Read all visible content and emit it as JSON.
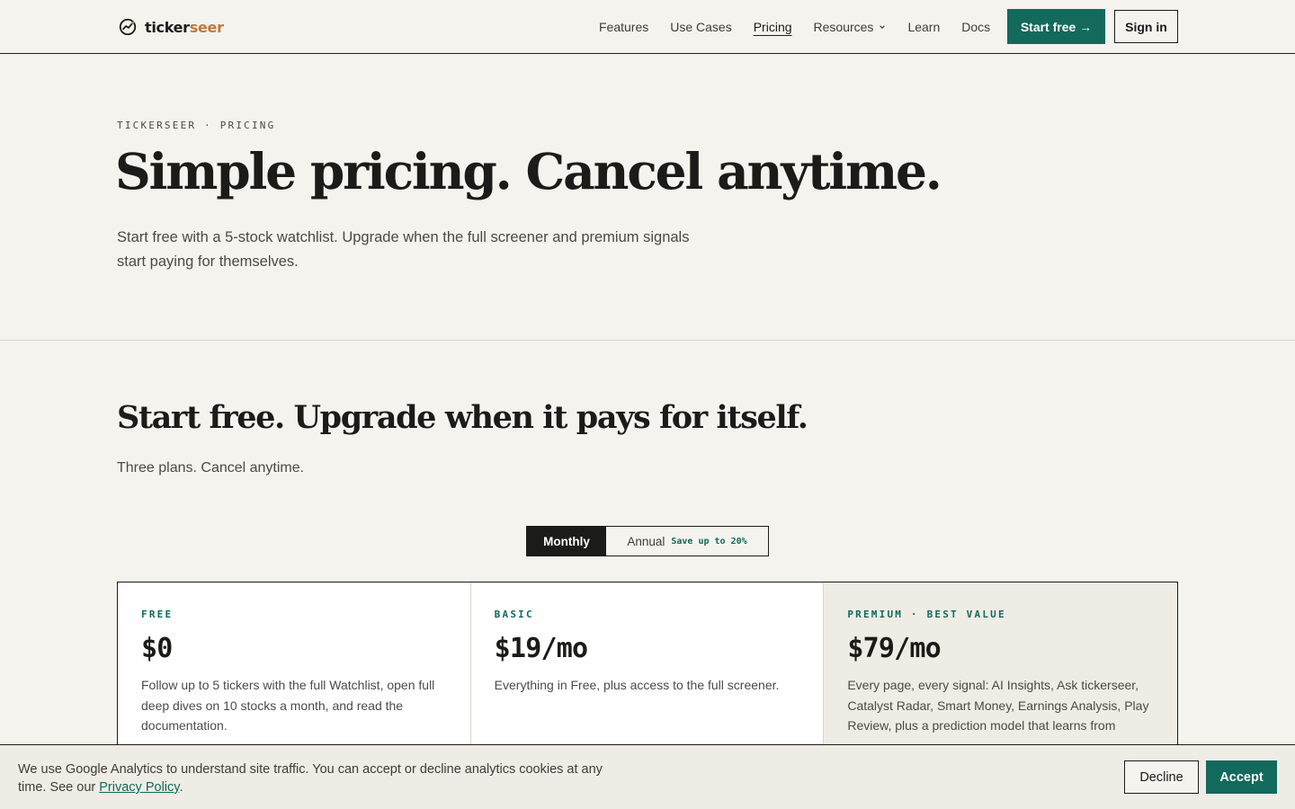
{
  "colors": {
    "accent": "#12695c",
    "brand_accent": "#c0783a",
    "ink": "#1b1b19",
    "background": "#f5f3ee",
    "premium_card_bg": "#efece5"
  },
  "nav": {
    "logo_icon": "trend-gauge-icon",
    "logo_primary": "ticker",
    "logo_accent": "seer",
    "links": [
      {
        "label": "Features"
      },
      {
        "label": "Use Cases"
      },
      {
        "label": "Pricing",
        "active": true
      },
      {
        "label": "Resources",
        "has_dropdown": true
      },
      {
        "label": "Learn"
      },
      {
        "label": "Docs"
      }
    ],
    "start_free": "Start free →",
    "sign_in": "Sign in"
  },
  "hero": {
    "eyebrow": "TICKERSEER · PRICING",
    "title": "Simple pricing. Cancel anytime.",
    "subtitle": "Start free with a 5-stock watchlist. Upgrade when the full screener and premium signals start paying for themselves."
  },
  "pricing": {
    "title": "Start free. Upgrade when it pays for itself.",
    "subtitle": "Three plans. Cancel anytime.",
    "billing_toggle": {
      "monthly": "Monthly",
      "annual": "Annual",
      "annual_badge": "Save up to 20%",
      "selected": "Monthly"
    },
    "plans": [
      {
        "name": "FREE",
        "price": "$0",
        "description": "Follow up to 5 tickers with the full Watchlist, open full deep dives on 10 stocks a month, and read the documentation."
      },
      {
        "name": "BASIC",
        "price": "$19/mo",
        "description": "Everything in Free, plus access to the full screener."
      },
      {
        "name": "PREMIUM · BEST VALUE",
        "price": "$79/mo",
        "description": "Every page, every signal: AI Insights, Ask tickerseer, Catalyst Radar, Smart Money, Earnings Analysis, Play Review, plus a prediction model that learns from"
      }
    ]
  },
  "cookie_banner": {
    "text_before": "We use Google Analytics to understand site traffic. You can accept or decline analytics cookies at any time. See our ",
    "link_text": "Privacy Policy",
    "text_after": ".",
    "decline": "Decline",
    "accept": "Accept"
  }
}
